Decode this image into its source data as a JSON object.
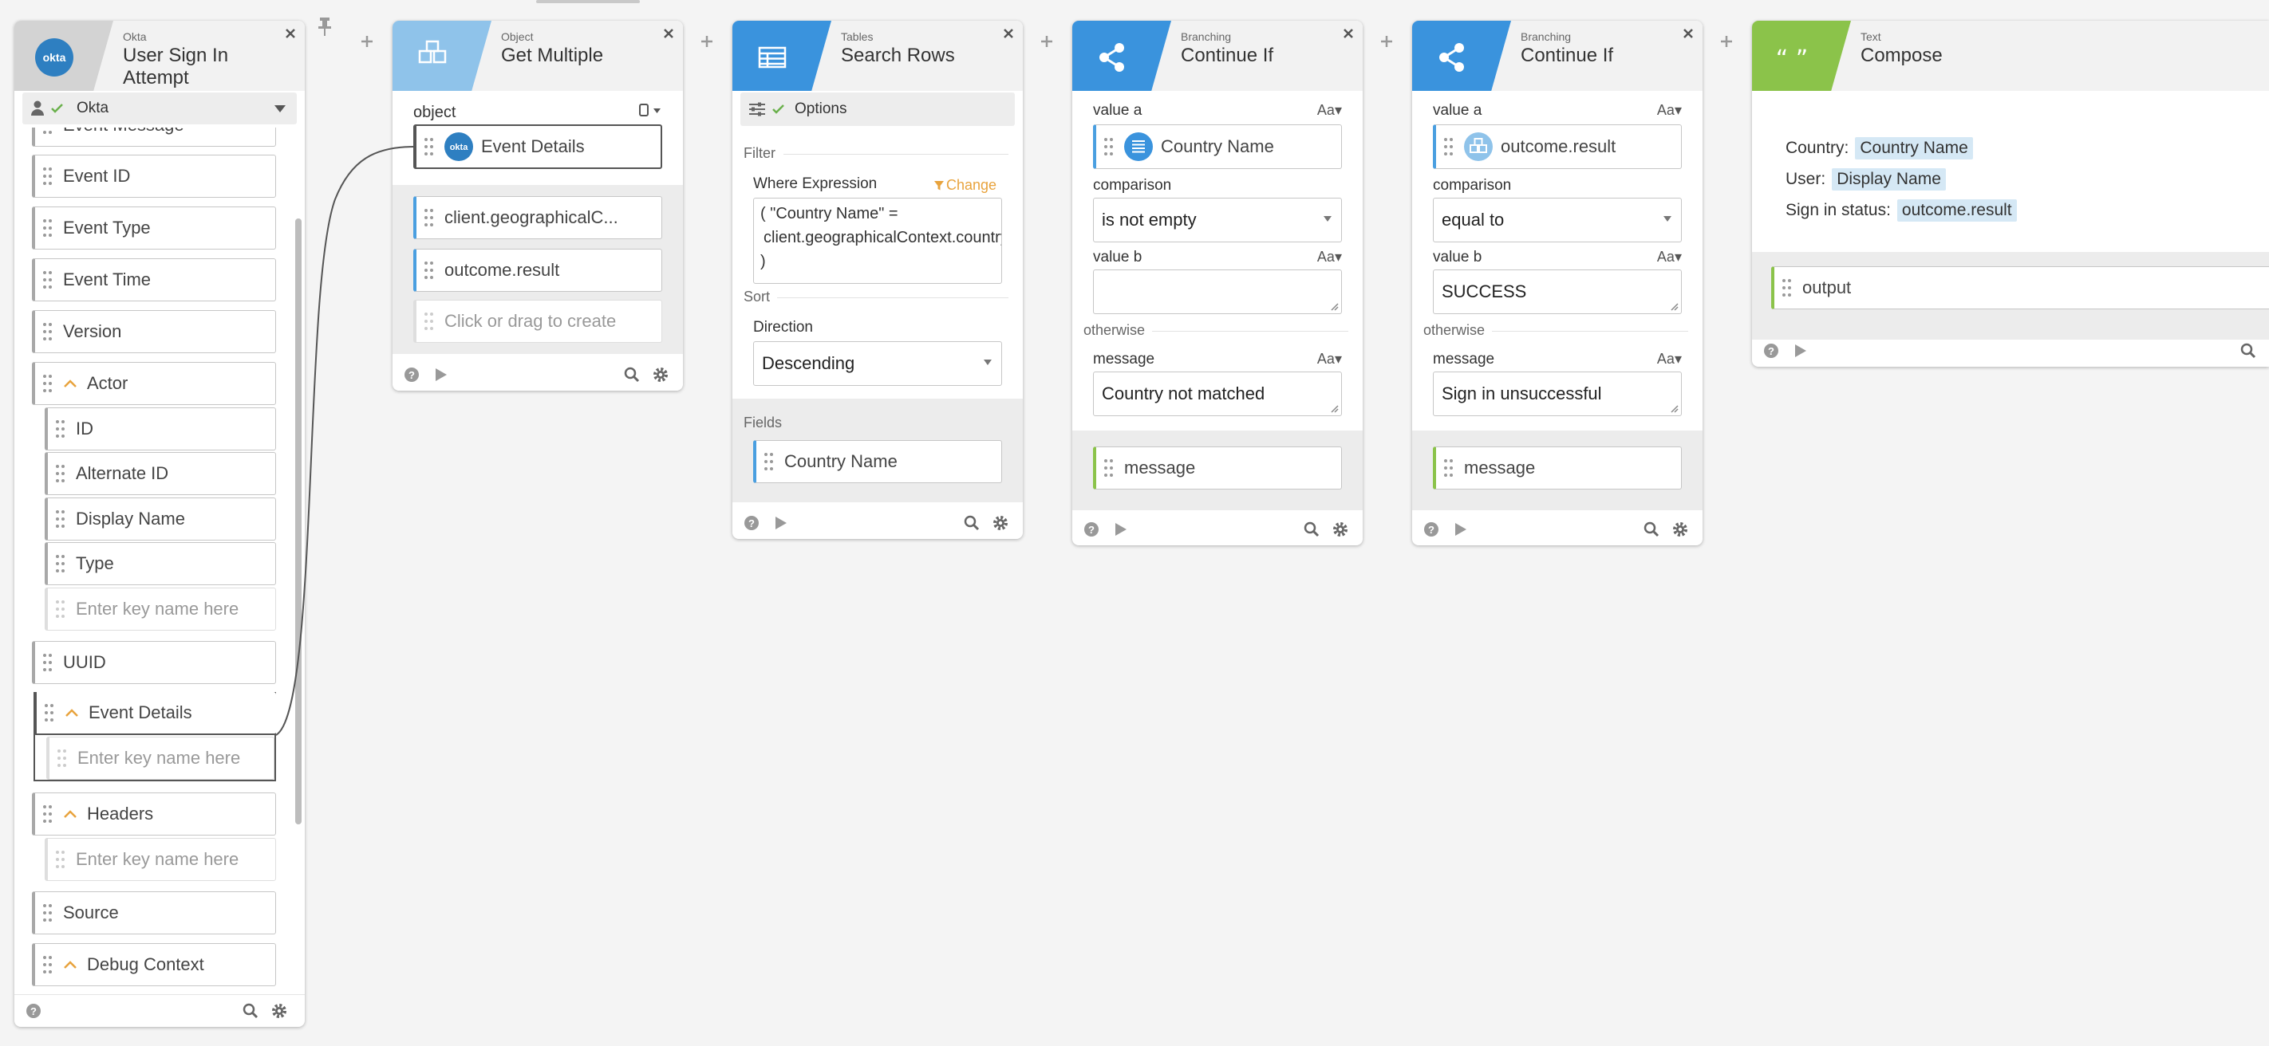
{
  "canvas": {
    "connector": "curve"
  },
  "cards": {
    "okta": {
      "category": "Okta",
      "title": "User Sign In Attempt",
      "connection": "Okta",
      "fields": {
        "cut": "Event Message",
        "event_id": "Event ID",
        "event_type": "Event Type",
        "event_time": "Event Time",
        "version": "Version",
        "actor": "Actor",
        "actor_id": "ID",
        "actor_alt_id": "Alternate ID",
        "actor_display": "Display Name",
        "actor_type": "Type",
        "actor_placeholder": "Enter key name here",
        "uuid": "UUID",
        "event_details": "Event Details",
        "event_details_placeholder": "Enter key name here",
        "headers": "Headers",
        "headers_placeholder": "Enter key name here",
        "source": "Source",
        "debug_context": "Debug Context"
      }
    },
    "object": {
      "category": "Object",
      "title": "Get Multiple",
      "object_label": "object",
      "object_input": "Event Details",
      "outputs": [
        "client.geographicalC...",
        "outcome.result"
      ],
      "placeholder": "Click or drag to create"
    },
    "tables": {
      "category": "Tables",
      "title": "Search Rows",
      "options": "Options",
      "filter_label": "Filter",
      "where_label": "Where Expression",
      "change": "Change",
      "expr_line1": "( \"Country Name\" =",
      "expr_line2": "client.geographicalContext.country",
      "expr_line3": ")",
      "sort_label": "Sort",
      "direction_label": "Direction",
      "direction_value": "Descending",
      "fields_label": "Fields",
      "field_out": "Country Name"
    },
    "branch1": {
      "category": "Branching",
      "title": "Continue If",
      "value_a_label": "value a",
      "value_a": "Country Name",
      "comparison_label": "comparison",
      "comparison": "is not empty",
      "value_b_label": "value b",
      "value_b": "",
      "otherwise": "otherwise",
      "message_label": "message",
      "message": "Country not matched",
      "output": "message",
      "aa": "Aa"
    },
    "branch2": {
      "category": "Branching",
      "title": "Continue If",
      "value_a_label": "value a",
      "value_a": "outcome.result",
      "comparison_label": "comparison",
      "comparison": "equal to",
      "value_b_label": "value b",
      "value_b": "SUCCESS",
      "otherwise": "otherwise",
      "message_label": "message",
      "message": "Sign in unsuccessful",
      "output": "message",
      "aa": "Aa"
    },
    "compose": {
      "category": "Text",
      "title": "Compose",
      "line1_label": "Country:",
      "line1_chip": "Country Name",
      "line2_label": "User:",
      "line2_chip": "Display Name",
      "line3_label": "Sign in status:",
      "line3_chip": "outcome.result",
      "output": "output"
    }
  },
  "colors": {
    "okta_band": "#cfcfcf",
    "object_band": "#8fc3ea",
    "tables_band": "#3a93dd",
    "branch_band": "#3a93dd",
    "compose_band": "#8bc34a",
    "link": "#4a9fe0",
    "change": "#e8a33d"
  }
}
